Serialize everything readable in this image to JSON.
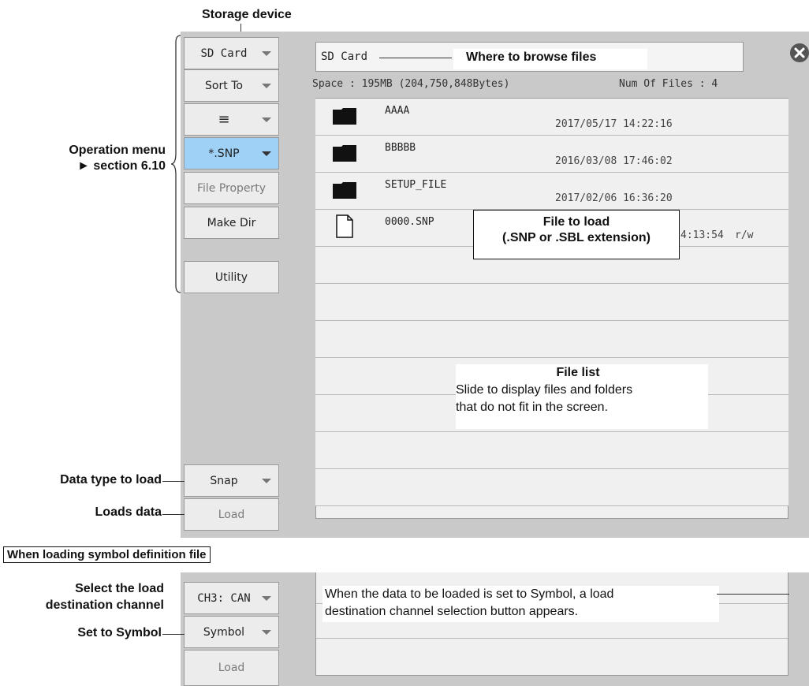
{
  "annotations": {
    "storage_device": "Storage device",
    "operation_menu_1": "Operation menu",
    "operation_menu_2": "► section 6.10",
    "where_to_browse": "Where to browse files",
    "file_to_load_1": "File to load",
    "file_to_load_2": "(.SNP or .SBL extension)",
    "file_list_title": "File list",
    "file_list_desc_1": "Slide to display files and folders",
    "file_list_desc_2": "that do not fit in the screen.",
    "data_type_to_load": "Data type to load",
    "loads_data": "Loads data",
    "symbol_section_title": "When loading symbol definition file",
    "select_channel_1": "Select the load",
    "select_channel_2": "destination channel",
    "set_to_symbol": "Set to Symbol",
    "symbol_note_1": "When the data to be loaded is set to Symbol, a load",
    "symbol_note_2": "destination channel selection button appears."
  },
  "menu": {
    "storage": "SD Card",
    "sort": "Sort To",
    "view": "≡",
    "filter": "*.SNP",
    "file_property": "File Property",
    "make_dir": "Make Dir",
    "utility": "Utility",
    "data_type": "Snap",
    "load": "Load"
  },
  "browser": {
    "path": "SD Card",
    "space": "Space : 195MB (204,750,848Bytes)",
    "num_files": "Num Of Files : 4",
    "files": [
      {
        "name": "AAAA",
        "date": "2017/05/17 14:22:16",
        "type": "folder-icon"
      },
      {
        "name": "BBBBB",
        "date": "2016/03/08 17:46:02",
        "type": "folder-icon"
      },
      {
        "name": "SETUP_FILE",
        "date": "2017/02/06 16:36:20",
        "type": "folder-icon"
      },
      {
        "name": "0000.SNP",
        "date": "4:13:54",
        "attr": "r/w",
        "type": "file-icon"
      }
    ]
  },
  "symbol_panel": {
    "channel": "CH3: CAN",
    "data_type": "Symbol",
    "load": "Load"
  },
  "colors": {
    "panel": "#c9c9c9",
    "button": "#ececec",
    "selected": "#9fd0f5",
    "list_row": "#f0f0f0"
  }
}
